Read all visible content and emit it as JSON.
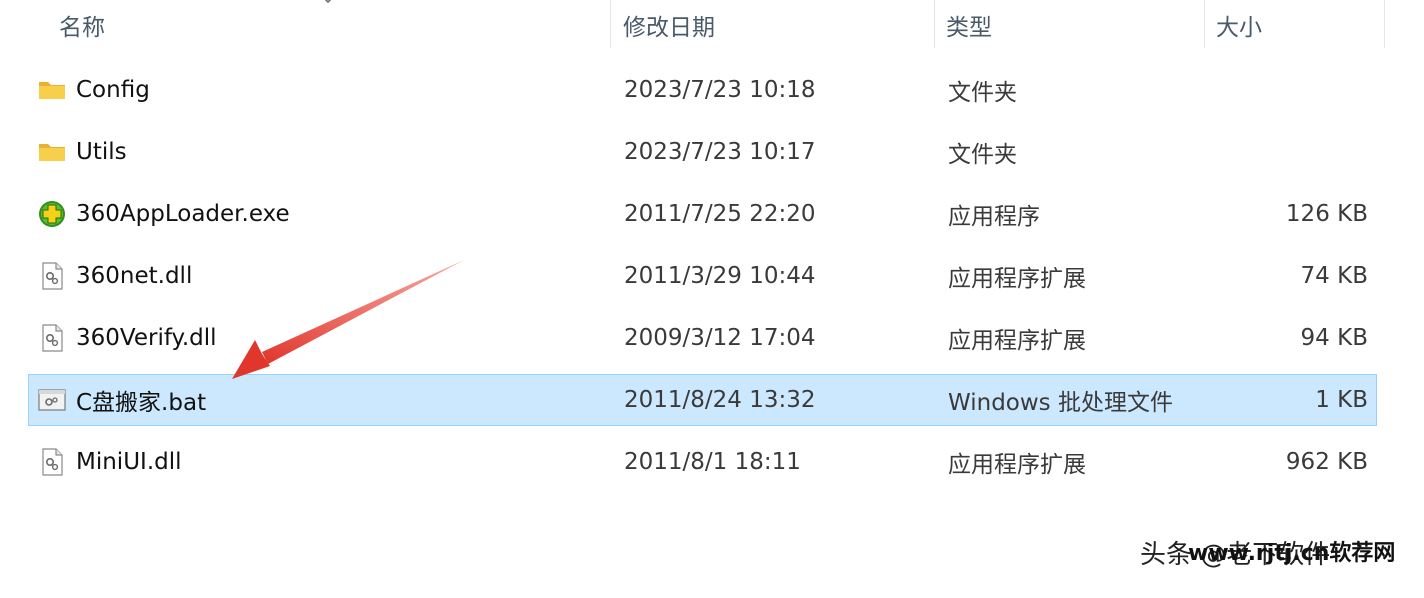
{
  "columns": {
    "name": "名称",
    "date": "修改日期",
    "type": "类型",
    "size": "大小"
  },
  "files": [
    {
      "icon": "folder-icon",
      "name": "Config",
      "date": "2023/7/23 10:18",
      "type": "文件夹",
      "size": ""
    },
    {
      "icon": "folder-icon",
      "name": "Utils",
      "date": "2023/7/23 10:17",
      "type": "文件夹",
      "size": ""
    },
    {
      "icon": "app-exe-icon",
      "name": "360AppLoader.exe",
      "date": "2011/7/25 22:20",
      "type": "应用程序",
      "size": "126 KB"
    },
    {
      "icon": "dll-file-icon",
      "name": "360net.dll",
      "date": "2011/3/29 10:44",
      "type": "应用程序扩展",
      "size": "74 KB"
    },
    {
      "icon": "dll-file-icon",
      "name": "360Verify.dll",
      "date": "2009/3/12 17:04",
      "type": "应用程序扩展",
      "size": "94 KB"
    },
    {
      "icon": "batch-file-icon",
      "name": "C盘搬家.bat",
      "date": "2011/8/24 13:32",
      "type": "Windows 批处理文件",
      "size": "1 KB",
      "selected": true
    },
    {
      "icon": "dll-file-icon",
      "name": "MiniUI.dll",
      "date": "2011/8/1 18:11",
      "type": "应用程序扩展",
      "size": "962 KB"
    }
  ],
  "watermark": {
    "back": "头条 @老下软件",
    "front": "www.rjtj.cn软荐网"
  },
  "colors": {
    "selection": "#cce8ff",
    "selection_border": "#99d1ff",
    "arrow": "#e8453c",
    "folder": "#f4c542"
  }
}
